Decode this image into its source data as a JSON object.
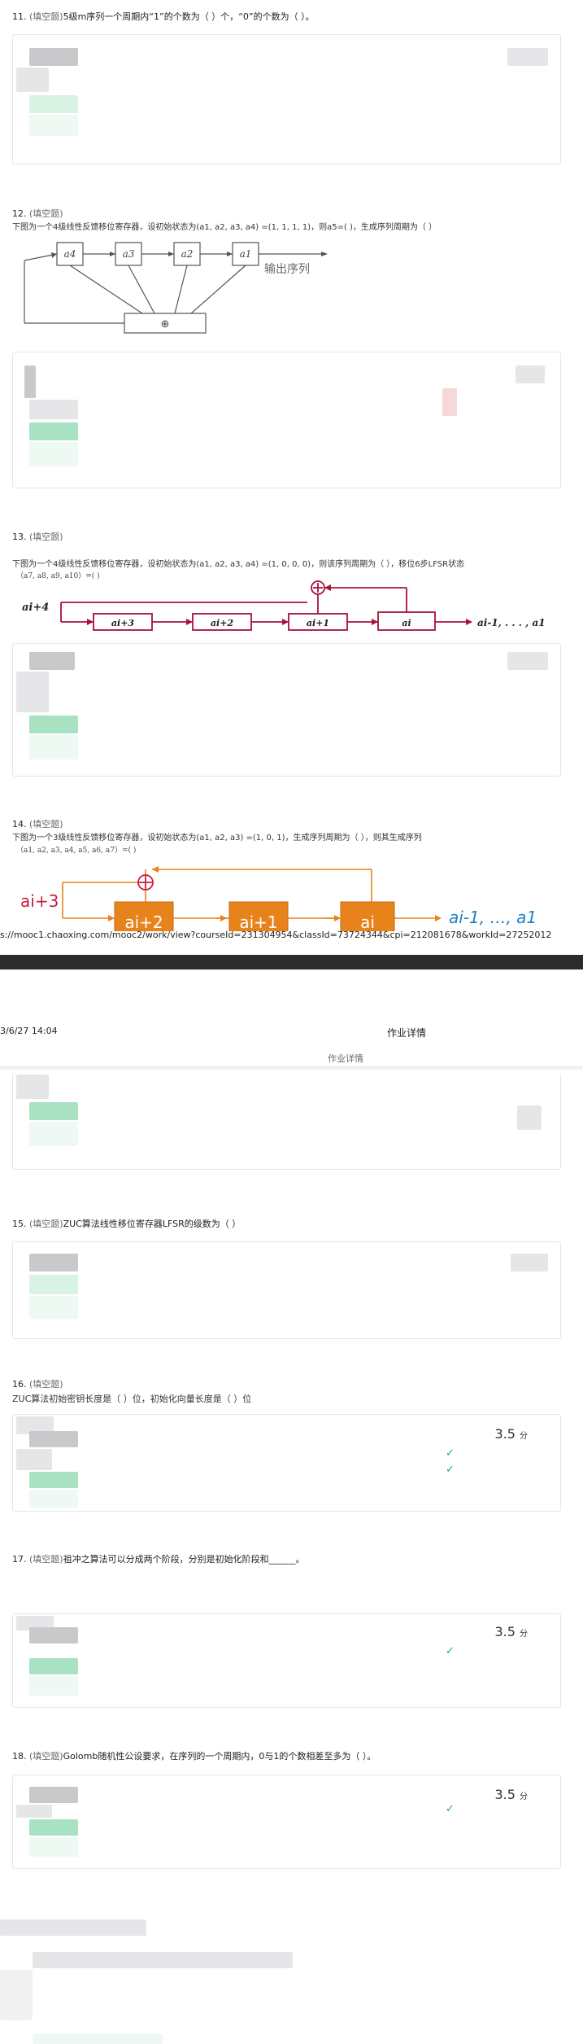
{
  "q11": {
    "number": "11.",
    "type": "(填空题)",
    "text": "5级m序列一个周期内“1”的个数为（ ）个，“0”的个数为（ ）。"
  },
  "q12": {
    "number": "12.",
    "type": "(填空题)",
    "text": "下图为一个4级线性反馈移位寄存器，设初始状态为(a1, a2, a3, a4) =(1, 1, 1, 1)，则a5=(      )，生成序列周期为（      ）",
    "diagram": {
      "cells": [
        "a4",
        "a3",
        "a2",
        "a1"
      ],
      "xor": "⊕",
      "output_label": "输出序列"
    }
  },
  "q13": {
    "number": "13.",
    "type": "(填空题)",
    "text": "下图为一个4级线性反馈移位寄存器，设初始状态为(a1, a2, a3, a4) =(1, 0, 0, 0)，则该序列周期为（      ），移位6步LFSR状态",
    "text2": "（a7, a8, a9, a10）=(            )",
    "diagram": {
      "input_label": "ai+4",
      "cells": [
        "ai+3",
        "ai+2",
        "ai+1",
        "ai"
      ],
      "output_label": "ai-1, . . . , a1"
    }
  },
  "q14": {
    "number": "14.",
    "type": "(填空题)",
    "text": "下图为一个3级线性反馈移位寄存器，设初始状态为(a1, a2, a3) =(1, 0, 1)，生成序列周期为（      ），则其生成序列",
    "text2": "（a1, a2, a3, a4, a5, a6, a7）=(                    )",
    "diagram": {
      "input_label": "ai+3",
      "cells": [
        "ai+2",
        "ai+1",
        "ai"
      ],
      "output_label": "ai-1, …, a1"
    }
  },
  "url": "s://mooc1.chaoxing.com/mooc2/work/view?courseId=231304954&classId=73724344&cpi=212081678&workId=27252012",
  "page2": {
    "date": "3/6/27 14:04",
    "title": "作业详情",
    "subtitle": "作业详情"
  },
  "q15": {
    "number": "15.",
    "type": "(填空题)",
    "text": "ZUC算法线性移位寄存器LFSR的级数为（ ）"
  },
  "q16": {
    "number": "16.",
    "type": "(填空题)",
    "text": "ZUC算法初始密钥长度是（ ）位，初始化向量长度是（ ）位",
    "score": "3.5",
    "score_unit": "分",
    "check": "✓"
  },
  "q17": {
    "number": "17.",
    "type": "(填空题)",
    "text": "祖冲之算法可以分成两个阶段，分别是初始化阶段和______。",
    "score": "3.5",
    "score_unit": "分",
    "check": "✓"
  },
  "q18": {
    "number": "18.",
    "type": "(填空题)",
    "text": "Golomb随机性公设要求，在序列的一个周期内，0与1的个数相差至多为（      ）。",
    "score": "3.5",
    "score_unit": "分",
    "check": "✓"
  },
  "colors": {
    "accent_green": "#18b05a",
    "lfsr_red": "#a8123a",
    "lfsr_orange": "#e8821a",
    "output_blue": "#1d7fc4"
  }
}
